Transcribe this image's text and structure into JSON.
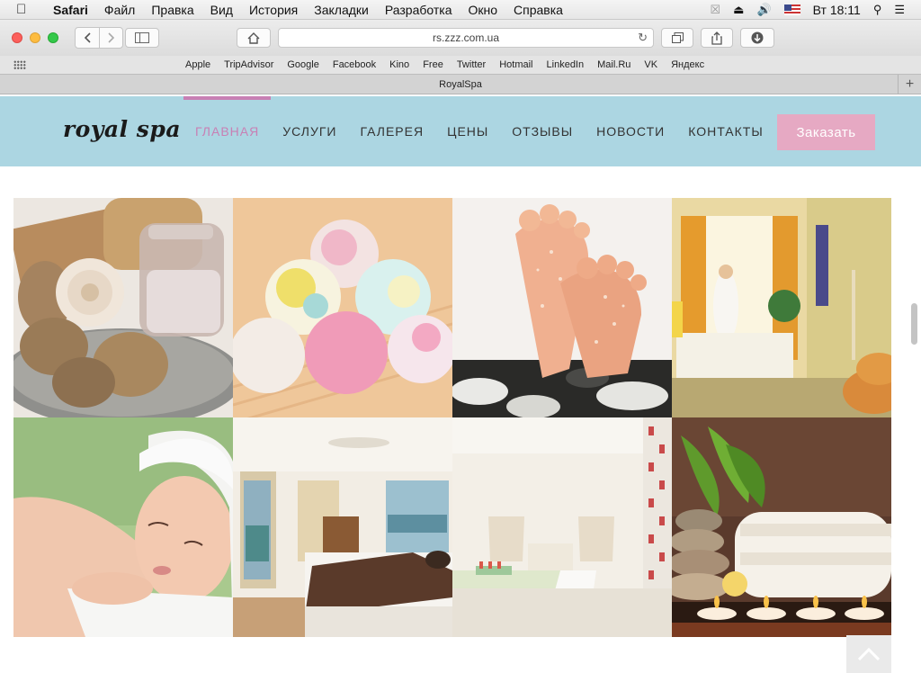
{
  "menubar": {
    "app": "Safari",
    "items": [
      "Файл",
      "Правка",
      "Вид",
      "История",
      "Закладки",
      "Разработка",
      "Окно",
      "Справка"
    ],
    "clock": "Вт 18:11"
  },
  "browser": {
    "url": "rs.zzz.com.ua",
    "favorites": [
      "Apple",
      "TripAdvisor",
      "Google",
      "Facebook",
      "Kino",
      "Free",
      "Twitter",
      "Hotmail",
      "LinkedIn",
      "Mail.Ru",
      "VK",
      "Яндекс"
    ],
    "tab_title": "RoyalSpa"
  },
  "site": {
    "logo": "royal spa",
    "nav": [
      "ГЛАВНАЯ",
      "УСЛУГИ",
      "ГАЛЕРЕЯ",
      "ЦЕНЫ",
      "ОТЗЫВЫ",
      "НОВОСТИ",
      "КОНТАКТЫ"
    ],
    "active_nav": 0,
    "order_button": "Заказать",
    "colors": {
      "header_bg": "#acd6e2",
      "accent": "#c880b4",
      "button_bg": "#e6a9c3"
    }
  },
  "gallery": {
    "tiles": [
      "nutmeg-and-salt-jar",
      "bath-bombs",
      "feet-on-stones",
      "spa-bathroom",
      "woman-with-towel",
      "hotel-bedroom",
      "pedicure-room",
      "stones-towel-candles"
    ]
  }
}
